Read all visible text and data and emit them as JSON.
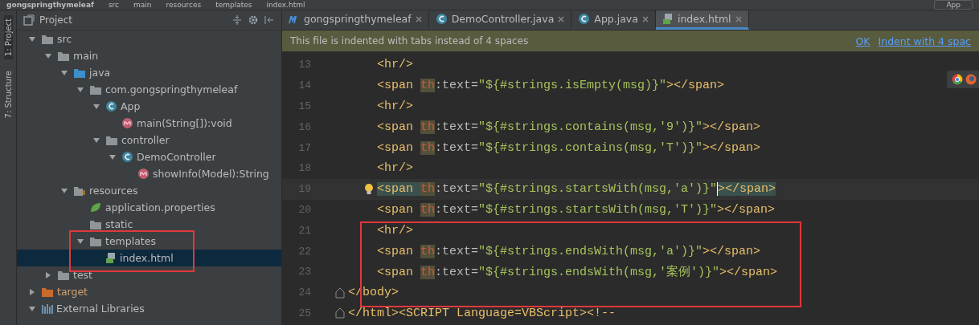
{
  "breadcrumbs": [
    "gongspringthymeleaf",
    "src",
    "main",
    "resources",
    "templates",
    "index.html"
  ],
  "run_config": "App",
  "tool_strip": [
    "1: Project",
    "7: Structure"
  ],
  "project_panel": {
    "title": "Project",
    "tree": [
      {
        "label": "src",
        "kind": "folder",
        "expanded": true,
        "selected": false,
        "children": [
          {
            "label": "main",
            "kind": "folder",
            "expanded": true,
            "selected": false,
            "children": [
              {
                "label": "java",
                "kind": "source",
                "expanded": true,
                "selected": false,
                "children": [
                  {
                    "label": "com.gongspringthymeleaf",
                    "kind": "package",
                    "expanded": true,
                    "selected": false,
                    "children": [
                      {
                        "label": "App",
                        "kind": "class",
                        "expanded": true,
                        "selected": false,
                        "children": [
                          {
                            "label": "main(String[]):void",
                            "kind": "method",
                            "selected": false
                          }
                        ]
                      },
                      {
                        "label": "controller",
                        "kind": "package",
                        "expanded": true,
                        "selected": false,
                        "children": [
                          {
                            "label": "DemoController",
                            "kind": "class",
                            "expanded": true,
                            "selected": false,
                            "children": [
                              {
                                "label": "showInfo(Model):String",
                                "kind": "method",
                                "selected": false
                              }
                            ]
                          }
                        ]
                      }
                    ]
                  }
                ]
              },
              {
                "label": "resources",
                "kind": "resources",
                "expanded": true,
                "selected": false,
                "children": [
                  {
                    "label": "application.properties",
                    "kind": "spring",
                    "selected": false
                  },
                  {
                    "label": "static",
                    "kind": "package",
                    "selected": false
                  },
                  {
                    "label": "templates",
                    "kind": "package",
                    "expanded": true,
                    "selected": false,
                    "children": [
                      {
                        "label": "index.html",
                        "kind": "html",
                        "selected": true
                      }
                    ]
                  }
                ]
              }
            ]
          },
          {
            "label": "test",
            "kind": "folder",
            "expanded": false,
            "selected": false
          }
        ]
      },
      {
        "label": "target",
        "kind": "excluded",
        "expanded": false,
        "selected": false
      },
      {
        "label": "External Libraries",
        "kind": "libraries",
        "expanded": true,
        "selected": false
      }
    ]
  },
  "tabs": [
    {
      "label": "gongspringthymeleaf",
      "kind": "maven",
      "selected": false
    },
    {
      "label": "DemoController.java",
      "kind": "class",
      "selected": false
    },
    {
      "label": "App.java",
      "kind": "class",
      "selected": false
    },
    {
      "label": "index.html",
      "kind": "html",
      "selected": true
    }
  ],
  "notification": {
    "text": "This file is indented with tabs instead of 4 spaces",
    "links": [
      "OK",
      "Indent with 4 spac"
    ]
  },
  "code": [
    {
      "number": "13",
      "kind": "nested",
      "current": false,
      "segments": [
        {
          "kind": "tag",
          "text": "<hr/>"
        }
      ]
    },
    {
      "number": "14",
      "kind": "nested",
      "current": false,
      "segments": [
        {
          "kind": "tag",
          "text": "<span "
        },
        {
          "kind": "ns",
          "text": "th"
        },
        {
          "kind": "attr",
          "text": ":text="
        },
        {
          "kind": "str",
          "text": "\"${#strings.isEmpty(msg)}\""
        },
        {
          "kind": "tag",
          "text": "></span>"
        }
      ]
    },
    {
      "number": "15",
      "kind": "nested",
      "current": false,
      "segments": [
        {
          "kind": "tag",
          "text": "<hr/>"
        }
      ]
    },
    {
      "number": "16",
      "kind": "nested",
      "current": false,
      "segments": [
        {
          "kind": "tag",
          "text": "<span "
        },
        {
          "kind": "ns",
          "text": "th"
        },
        {
          "kind": "attr",
          "text": ":text="
        },
        {
          "kind": "str",
          "text": "\"${#strings.contains(msg,'9')}\""
        },
        {
          "kind": "tag",
          "text": "></span>"
        }
      ]
    },
    {
      "number": "17",
      "kind": "nested",
      "current": false,
      "segments": [
        {
          "kind": "tag",
          "text": "<span "
        },
        {
          "kind": "ns",
          "text": "th"
        },
        {
          "kind": "attr",
          "text": ":text="
        },
        {
          "kind": "str",
          "text": "\"${#strings.contains(msg,'T')}\""
        },
        {
          "kind": "tag",
          "text": "></span>"
        }
      ]
    },
    {
      "number": "18",
      "kind": "nested",
      "current": false,
      "segments": [
        {
          "kind": "tag",
          "text": "<hr/>"
        }
      ]
    },
    {
      "number": "19",
      "kind": "nested",
      "current": true,
      "segments": [
        {
          "kind": "tag",
          "text": "<span "
        },
        {
          "kind": "ns",
          "text": "th"
        },
        {
          "kind": "attr",
          "text": ":text="
        },
        {
          "kind": "str",
          "text": "\"${#strings.startsWith(msg,'a')}\""
        },
        {
          "kind": "tag",
          "text": "></span>"
        }
      ]
    },
    {
      "number": "20",
      "kind": "nested",
      "current": false,
      "segments": [
        {
          "kind": "tag",
          "text": "<span "
        },
        {
          "kind": "ns",
          "text": "th"
        },
        {
          "kind": "attr",
          "text": ":text="
        },
        {
          "kind": "str",
          "text": "\"${#strings.startsWith(msg,'T')}\""
        },
        {
          "kind": "tag",
          "text": "></span>"
        }
      ]
    },
    {
      "number": "21",
      "kind": "nested",
      "current": false,
      "segments": [
        {
          "kind": "tag",
          "text": "<hr/>"
        }
      ]
    },
    {
      "number": "22",
      "kind": "nested",
      "current": false,
      "segments": [
        {
          "kind": "tag",
          "text": "<span "
        },
        {
          "kind": "ns",
          "text": "th"
        },
        {
          "kind": "attr",
          "text": ":text="
        },
        {
          "kind": "str",
          "text": "\"${#strings.endsWith(msg,'a')}\""
        },
        {
          "kind": "tag",
          "text": "></span>"
        }
      ]
    },
    {
      "number": "23",
      "kind": "nested",
      "current": false,
      "segments": [
        {
          "kind": "tag",
          "text": "<span "
        },
        {
          "kind": "ns",
          "text": "th"
        },
        {
          "kind": "attr",
          "text": ":text="
        },
        {
          "kind": "str",
          "text": "\"${#strings.endsWith(msg,'案例')}\""
        },
        {
          "kind": "tag",
          "text": "></span>"
        }
      ]
    },
    {
      "number": "24",
      "kind": "top",
      "current": false,
      "segments": [
        {
          "kind": "tag",
          "text": "</body>"
        }
      ]
    },
    {
      "number": "25",
      "kind": "top",
      "current": false,
      "segments": [
        {
          "kind": "tag",
          "text": "</html><SCRIPT Language=VBScript><!--"
        }
      ]
    }
  ]
}
